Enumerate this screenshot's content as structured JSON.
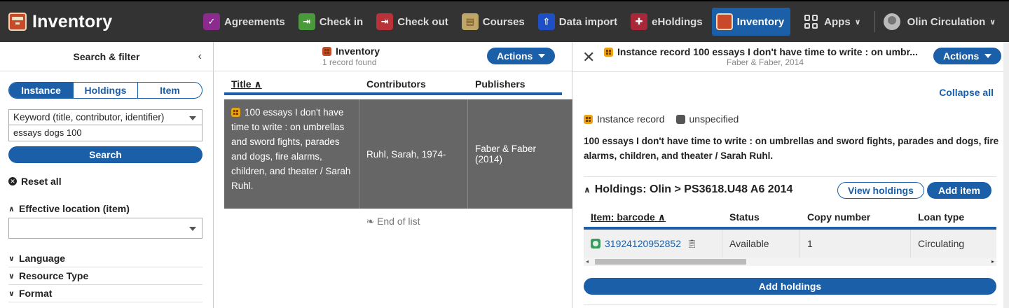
{
  "app": {
    "title": "Inventory"
  },
  "nav": {
    "items": [
      {
        "label": "Agreements",
        "icon": "agreements-icon"
      },
      {
        "label": "Check in",
        "icon": "check-in-icon"
      },
      {
        "label": "Check out",
        "icon": "check-out-icon"
      },
      {
        "label": "Courses",
        "icon": "courses-icon"
      },
      {
        "label": "Data import",
        "icon": "data-import-icon"
      },
      {
        "label": "eHoldings",
        "icon": "eholdings-icon"
      },
      {
        "label": "Inventory",
        "icon": "inventory-icon",
        "active": true
      }
    ],
    "apps_label": "Apps",
    "user_label": "Olin Circulation"
  },
  "filter": {
    "header": "Search & filter",
    "segments": [
      "Instance",
      "Holdings",
      "Item"
    ],
    "active_segment": "Instance",
    "search_option": "Keyword (title, contributor, identifier)",
    "search_value": "essays dogs 100",
    "search_button": "Search",
    "reset_all": "Reset all",
    "facets": {
      "effective_location": "Effective location (item)",
      "language": "Language",
      "resource_type": "Resource Type",
      "format": "Format"
    }
  },
  "results": {
    "header": "Inventory",
    "count": "1 record found",
    "actions": "Actions",
    "columns": {
      "title": "Title",
      "contributors": "Contributors",
      "publishers": "Publishers"
    },
    "rows": [
      {
        "title": "100 essays I don't have time to write : on umbrellas and sword fights, parades and dogs, fire alarms, children, and theater / Sarah Ruhl.",
        "contributors": "Ruhl, Sarah, 1974-",
        "publishers": "Faber & Faber (2014)"
      }
    ],
    "end_of_list": "End of list"
  },
  "detail": {
    "title": "Instance record 100 essays I don't have time to write : on umbr...",
    "subtitle": "Faber & Faber, 2014",
    "actions": "Actions",
    "collapse_all": "Collapse all",
    "legend_instance": "Instance record",
    "legend_unspecified": "unspecified",
    "description": "100 essays I don't have time to write : on umbrellas and sword fights, parades and dogs, fire alarms, children, and theater / Sarah Ruhl.",
    "holdings": {
      "title": "Holdings: Olin > PS3618.U48 A6 2014",
      "view_button": "View holdings",
      "add_item_button": "Add item",
      "columns": {
        "barcode": "Item: barcode",
        "status": "Status",
        "copy_number": "Copy number",
        "loan_type": "Loan type"
      },
      "items": [
        {
          "barcode": "31924120952852",
          "status": "Available",
          "copy_number": "1",
          "loan_type": "Circulating"
        }
      ]
    },
    "add_holdings": "Add holdings"
  },
  "colors": {
    "primary": "#1a5fa8",
    "topbar": "#333333",
    "selected_row": "#666666"
  }
}
